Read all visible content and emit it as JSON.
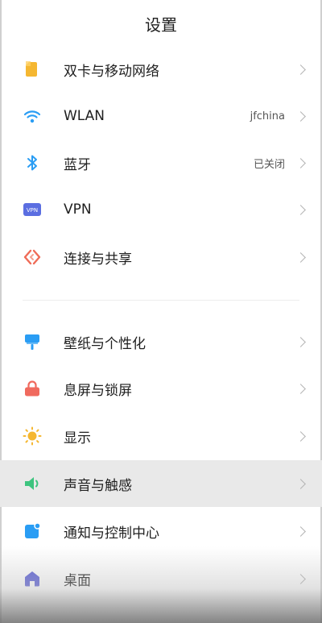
{
  "header": {
    "title": "设置"
  },
  "items": [
    {
      "label": "双卡与移动网络",
      "value": "",
      "icon": "sim-card-icon",
      "color": "#f5b731"
    },
    {
      "label": "WLAN",
      "value": "jfchina",
      "icon": "wifi-icon",
      "color": "#2a9df4"
    },
    {
      "label": "蓝牙",
      "value": "已关闭",
      "icon": "bluetooth-icon",
      "color": "#2a9df4"
    },
    {
      "label": "VPN",
      "value": "",
      "icon": "vpn-icon",
      "color": "#5b6ee1"
    },
    {
      "label": "连接与共享",
      "value": "",
      "icon": "connection-share-icon",
      "color": "#ef6b57"
    },
    {
      "label": "壁纸与个性化",
      "value": "",
      "icon": "wallpaper-icon",
      "color": "#2a9df4"
    },
    {
      "label": "息屏与锁屏",
      "value": "",
      "icon": "lock-icon",
      "color": "#f06a5e"
    },
    {
      "label": "显示",
      "value": "",
      "icon": "sun-icon",
      "color": "#f5b731"
    },
    {
      "label": "声音与触感",
      "value": "",
      "icon": "speaker-icon",
      "color": "#3dc47e"
    },
    {
      "label": "通知与控制中心",
      "value": "",
      "icon": "notification-icon",
      "color": "#2a9df4"
    },
    {
      "label": "桌面",
      "value": "",
      "icon": "home-icon",
      "color": "#5b5fd6"
    }
  ]
}
